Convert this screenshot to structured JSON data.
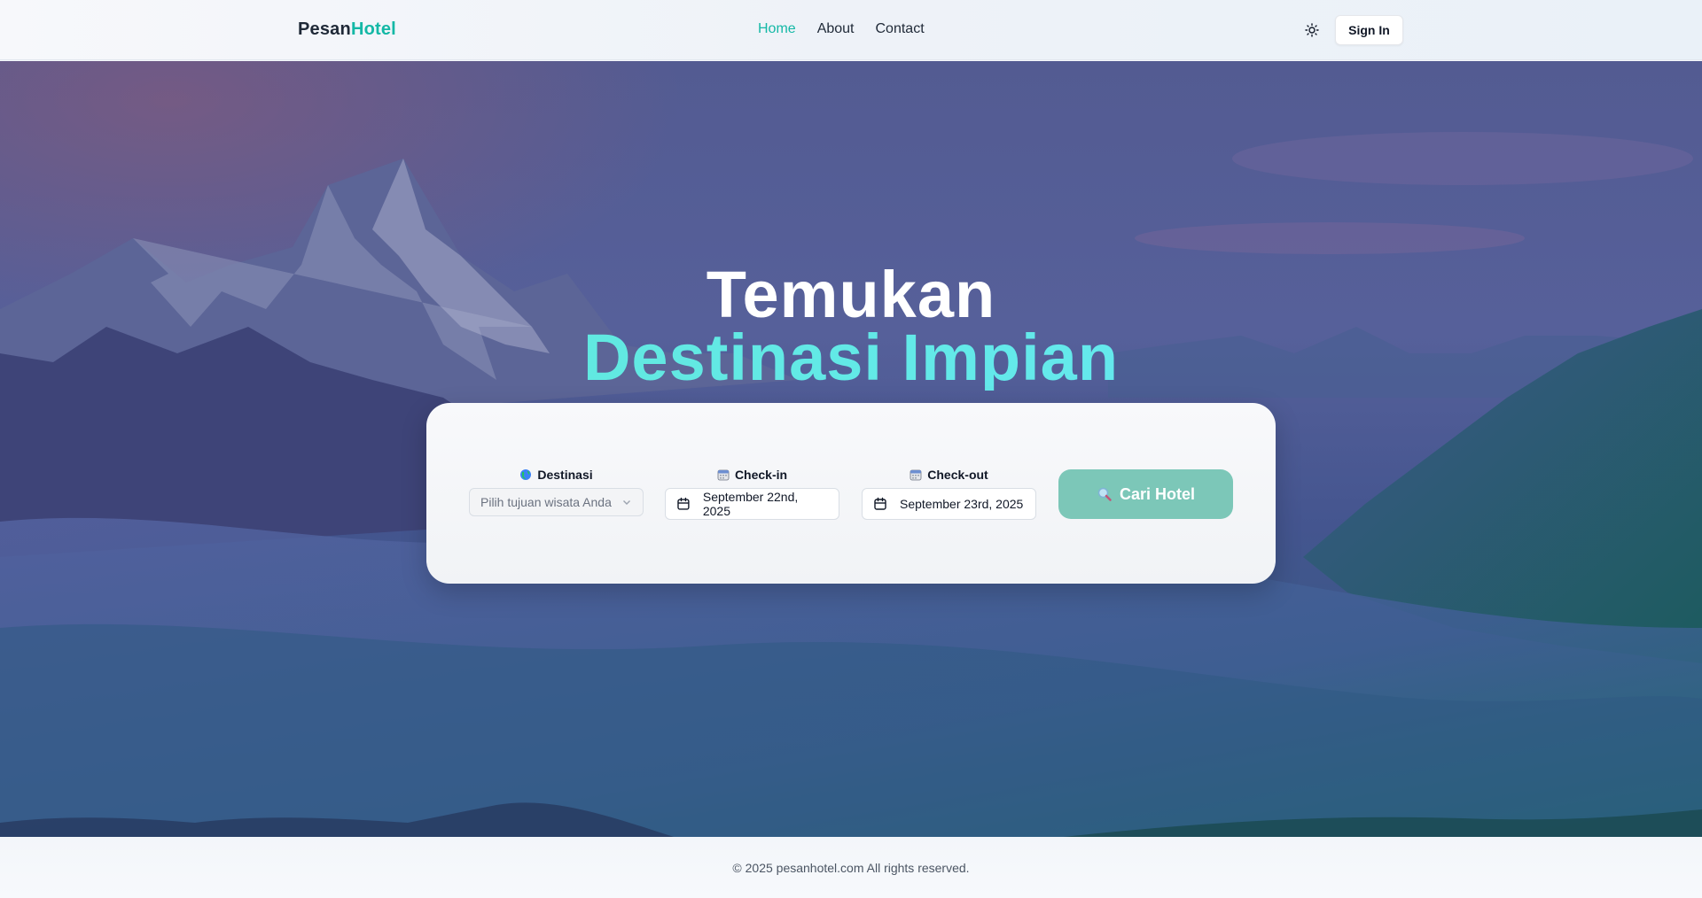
{
  "header": {
    "logo_part1": "Pesan",
    "logo_part2": "Hotel",
    "nav": [
      {
        "label": "Home",
        "active": true
      },
      {
        "label": "About",
        "active": false
      },
      {
        "label": "Contact",
        "active": false
      }
    ],
    "theme_icon": "sun-icon",
    "signin_label": "Sign In"
  },
  "hero": {
    "title_line1": "Temukan",
    "title_line2": "Destinasi Impian"
  },
  "search": {
    "destination": {
      "label": "Destinasi",
      "icon": "globe-icon",
      "placeholder": "Pilih tujuan wisata Anda"
    },
    "checkin": {
      "label": "Check-in",
      "icon": "calendar-icon",
      "value": "September 22nd, 2025"
    },
    "checkout": {
      "label": "Check-out",
      "icon": "calendar-icon",
      "value": "September 23rd, 2025"
    },
    "submit_label": "Cari Hotel",
    "submit_icon": "magnifier-icon"
  },
  "footer": {
    "text": "© 2025 pesanhotel.com All rights reserved."
  },
  "colors": {
    "accent": "#14b8a6",
    "button": "#7cc7b8",
    "title_gradient_start": "#5eead4",
    "title_gradient_end": "#67e8f9"
  }
}
